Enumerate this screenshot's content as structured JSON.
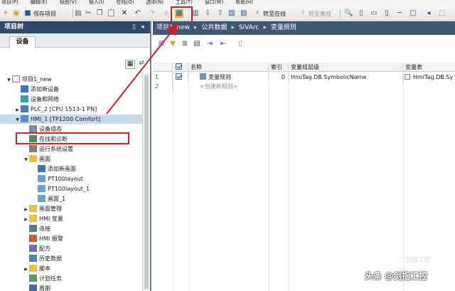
{
  "menu": [
    "项目(P)",
    "编辑(E)",
    "视图(V)",
    "插入(I)",
    "在线(O)",
    "选项(N)",
    "工具(T)",
    "窗口(W)",
    "帮助(H)"
  ],
  "toolbar": {
    "save_project": "保存项目",
    "go_online": "转至在线",
    "go_offline": "转至离线"
  },
  "left": {
    "title": "项目树",
    "tab": "设备",
    "tree": [
      {
        "label": "项目1_new",
        "level": 0,
        "icon": "project-icon",
        "expand": "open"
      },
      {
        "label": "添加新设备",
        "level": 1,
        "icon": "add-device-icon",
        "expand": ""
      },
      {
        "label": "设备和网络",
        "level": 1,
        "icon": "network-icon",
        "expand": ""
      },
      {
        "label": "PLC_2 [CPU 1513-1 PN]",
        "level": 1,
        "icon": "plc-icon",
        "expand": "closed"
      },
      {
        "label": "HMI_1 [TP1200 Comfort]",
        "level": 1,
        "icon": "hmi-icon",
        "expand": "open"
      },
      {
        "label": "设备组态",
        "level": 2,
        "icon": "device-config-icon",
        "expand": ""
      },
      {
        "label": "在线和诊断",
        "level": 2,
        "icon": "diagnostics-icon",
        "expand": ""
      },
      {
        "label": "运行系统设置",
        "level": 2,
        "icon": "runtime-settings-icon",
        "expand": ""
      },
      {
        "label": "画面",
        "level": 2,
        "icon": "folder-icon",
        "expand": "open"
      },
      {
        "label": "添加新画面",
        "level": 3,
        "icon": "add-screen-icon",
        "expand": ""
      },
      {
        "label": "PT100layout",
        "level": 3,
        "icon": "screen-icon",
        "expand": ""
      },
      {
        "label": "PT100layout_1",
        "level": 3,
        "icon": "screen-icon",
        "expand": ""
      },
      {
        "label": "画面_1",
        "level": 3,
        "icon": "screen-icon",
        "expand": ""
      },
      {
        "label": "画面管理",
        "level": 2,
        "icon": "folder-icon",
        "expand": "closed"
      },
      {
        "label": "HMI 变量",
        "level": 2,
        "icon": "folder-icon",
        "expand": "closed"
      },
      {
        "label": "连接",
        "level": 2,
        "icon": "connection-icon",
        "expand": ""
      },
      {
        "label": "HMI 报警",
        "level": 2,
        "icon": "alarm-icon",
        "expand": ""
      },
      {
        "label": "配方",
        "level": 2,
        "icon": "recipe-icon",
        "expand": ""
      },
      {
        "label": "历史数据",
        "level": 2,
        "icon": "history-icon",
        "expand": ""
      },
      {
        "label": "脚本",
        "level": 2,
        "icon": "folder-icon",
        "expand": "closed"
      },
      {
        "label": "计划任务",
        "level": 2,
        "icon": "schedule-icon",
        "expand": ""
      },
      {
        "label": "周期",
        "level": 2,
        "icon": "cycle-icon",
        "expand": ""
      }
    ]
  },
  "breadcrumb": [
    "项目1_new",
    "公共数据",
    "SiVArc",
    "变量规则"
  ],
  "grid": {
    "headers": [
      "名称",
      "索引",
      "变量组层级",
      "变量表"
    ],
    "rows": [
      {
        "num": "1",
        "name": "变量规则",
        "index": "0",
        "group": "HmiTag.DB.SymbolicName",
        "table": "HmiTag.DB.Sy"
      }
    ],
    "add_row_num": "2",
    "add_placeholder": "<创建新规则>"
  },
  "watermark": "头条 @剑指工控",
  "watermark_faint": "剑指工控",
  "colors": {
    "accent": "#2f4a66",
    "highlight": "#e01a22"
  }
}
